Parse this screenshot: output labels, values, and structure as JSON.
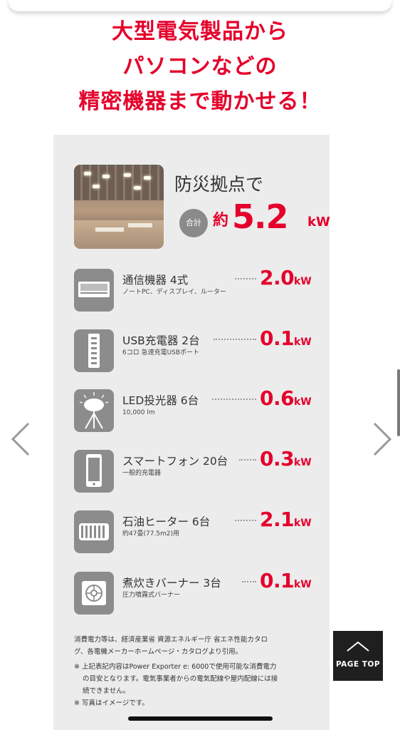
{
  "headline": {
    "line1": "大型電気製品から",
    "line2": "パソコンなどの",
    "line3": "精密機器まで動かせる！"
  },
  "summary": {
    "title": "防災拠点で",
    "badge": "合計",
    "approx": "約",
    "value": "5.2",
    "unit": "kW"
  },
  "items": [
    {
      "name": "通信機器 4式",
      "sub": "ノートPC、ディスプレイ、ルーター",
      "value": "2.0",
      "unit": "kW",
      "icon": "monitor-icon"
    },
    {
      "name": "USB充電器 2台",
      "sub": "6コロ 急速充電USBポート",
      "value": "0.1",
      "unit": "kW",
      "icon": "usb-charger-icon"
    },
    {
      "name": "LED投光器 6台",
      "sub": "10,000 lm",
      "value": "0.6",
      "unit": "kW",
      "icon": "floodlight-icon"
    },
    {
      "name": "スマートフォン 20台",
      "sub": "一般的充電器",
      "value": "0.3",
      "unit": "kW",
      "icon": "smartphone-icon"
    },
    {
      "name": "石油ヒーター 6台",
      "sub": "約47畳(77.5m2)用",
      "value": "2.1",
      "unit": "kW",
      "icon": "heater-icon"
    },
    {
      "name": "煮炊きバーナー 3台",
      "sub": "圧力噴霧式バーナー",
      "value": "0.1",
      "unit": "kW",
      "icon": "burner-icon"
    }
  ],
  "notes": {
    "line1": "消費電力等は、経済産業省 資源エネルギー庁 省エネ性能カタロ",
    "line2": "グ、各電機メーカーホームページ・カタログより引用。",
    "line3": "※ 上記表記内容はPower Exporter e: 6000で使用可能な消費電力",
    "line4": "の目安となります。電気事業者からの電気配線や屋内配線には接",
    "line5": "続できません。",
    "line6": "※ 写真はイメージです。"
  },
  "page_top": {
    "label": "PAGE TOP"
  },
  "colors": {
    "accent": "#e4002b",
    "panel": "#ececec",
    "icon_bg": "#8c8c8c"
  }
}
